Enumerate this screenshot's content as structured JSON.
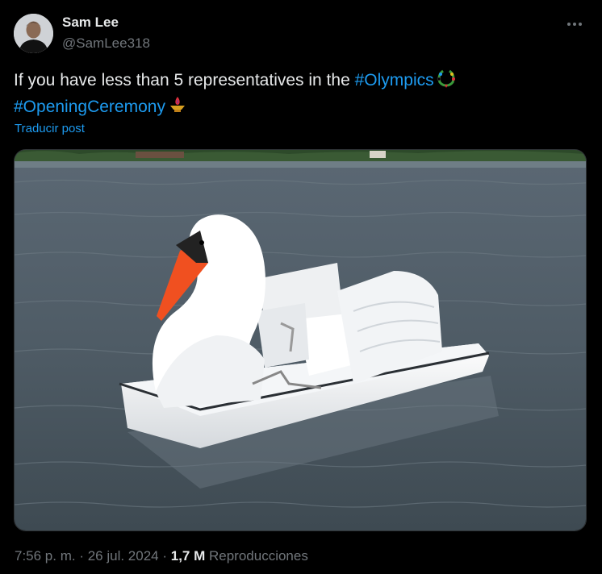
{
  "author": {
    "display_name": "Sam Lee",
    "handle": "@SamLee318",
    "avatar_icon": "user-avatar"
  },
  "tweet": {
    "text_prefix": "If you have less than 5 representatives in the ",
    "hashtag_1": "#Olympics",
    "hashtag_2": "#OpeningCeremony",
    "emoji_1": "laurel-wreath-icon",
    "emoji_2": "flame-lamp-icon",
    "translate_label": "Traducir post"
  },
  "media": {
    "subject": "swan-pedal-boat"
  },
  "meta": {
    "time": "7:56 p. m.",
    "sep1": " · ",
    "date": "26 jul. 2024",
    "sep2": " · ",
    "views_count": "1,7 M",
    "views_label": " Reproducciones"
  },
  "colors": {
    "background": "#000000",
    "text": "#e7e9ea",
    "muted": "#71767b",
    "link": "#1d9bf0"
  }
}
